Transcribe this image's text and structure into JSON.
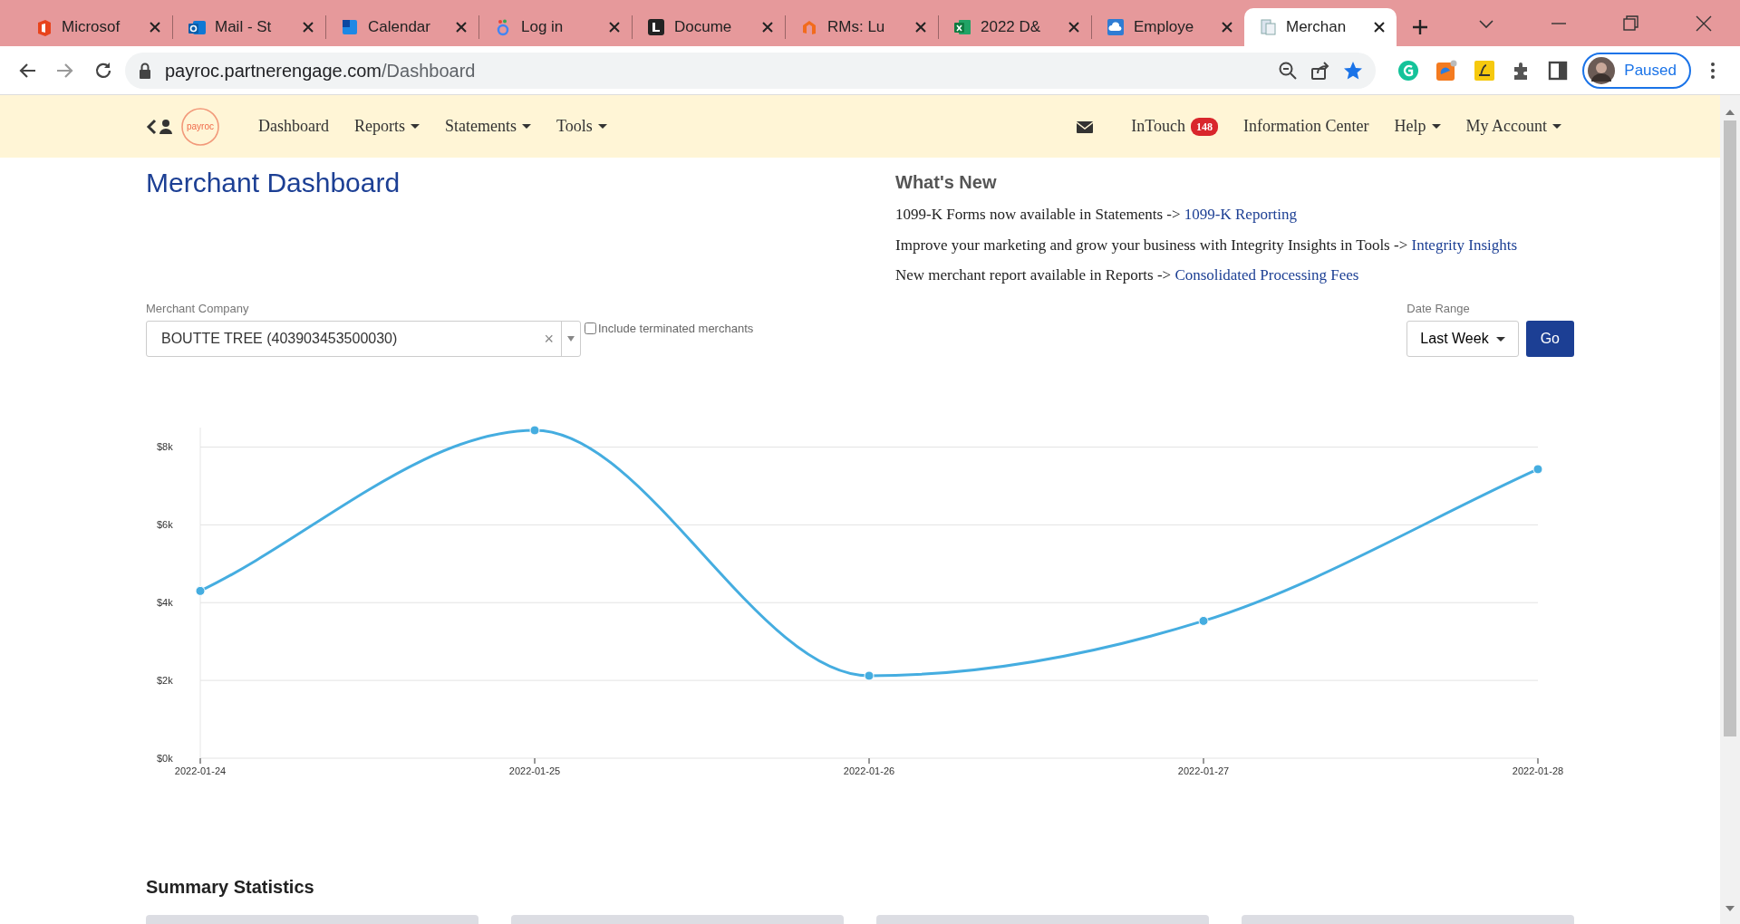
{
  "browser": {
    "tabs": [
      {
        "title": "Microsof",
        "selected": false
      },
      {
        "title": "Mail - St",
        "selected": false
      },
      {
        "title": "Calendar",
        "selected": false
      },
      {
        "title": "Log in",
        "selected": false
      },
      {
        "title": "Docume",
        "selected": false
      },
      {
        "title": "RMs: Lu",
        "selected": false
      },
      {
        "title": "2022 D&",
        "selected": false
      },
      {
        "title": "Employe",
        "selected": false
      },
      {
        "title": "Merchan",
        "selected": true
      }
    ],
    "url_host": "payroc.partnerengage.com",
    "url_path": "/Dashboard",
    "profile": "Paused"
  },
  "navbar": {
    "logo": "payroc",
    "left_items": [
      {
        "label": "Dashboard",
        "dropdown": false
      },
      {
        "label": "Reports",
        "dropdown": true
      },
      {
        "label": "Statements",
        "dropdown": true
      },
      {
        "label": "Tools",
        "dropdown": true
      }
    ],
    "intouch": {
      "label": "InTouch",
      "badge": "148"
    },
    "right_items": [
      {
        "label": "Information Center",
        "dropdown": false
      },
      {
        "label": "Help",
        "dropdown": true
      },
      {
        "label": "My Account",
        "dropdown": true
      }
    ]
  },
  "page_title": "Merchant Dashboard",
  "whats_new": {
    "title": "What's New",
    "items": [
      {
        "text": "1099-K Forms now available in Statements ->",
        "link": "1099-K Reporting"
      },
      {
        "text": "Improve your marketing and grow your business with Integrity Insights in Tools ->",
        "link": "Integrity Insights"
      },
      {
        "text": "New merchant report available in Reports ->",
        "link": "Consolidated Processing Fees"
      }
    ]
  },
  "filters": {
    "merchant_label": "Merchant Company",
    "merchant_value": "BOUTTE TREE (403903453500030)",
    "clear": "×",
    "terminated": {
      "label": "Include terminated merchants",
      "checked": false
    },
    "date_label": "Date Range",
    "date_value": "Last Week",
    "go": "Go"
  },
  "chart_data": {
    "type": "line",
    "categories": [
      "2022-01-24",
      "2022-01-25",
      "2022-01-26",
      "2022-01-27",
      "2022-01-28"
    ],
    "series": [
      {
        "color": "#45ade0",
        "marker": true,
        "values": [
          4.3,
          8.43,
          2.12,
          3.53,
          7.43
        ]
      }
    ],
    "ylim": [
      0,
      8.5
    ],
    "grid": true,
    "yticks": [
      {
        "value": 0,
        "label": "$0k"
      },
      {
        "value": 2,
        "label": "$2k"
      },
      {
        "value": 4,
        "label": "$4k"
      },
      {
        "value": 6,
        "label": "$6k"
      },
      {
        "value": 8,
        "label": "$8k"
      }
    ]
  },
  "summary": {
    "title": "Summary Statistics",
    "cards": [
      {
        "kind": "card"
      },
      {
        "kind": "card"
      },
      {
        "kind": "card"
      },
      {
        "kind": "card"
      }
    ]
  }
}
